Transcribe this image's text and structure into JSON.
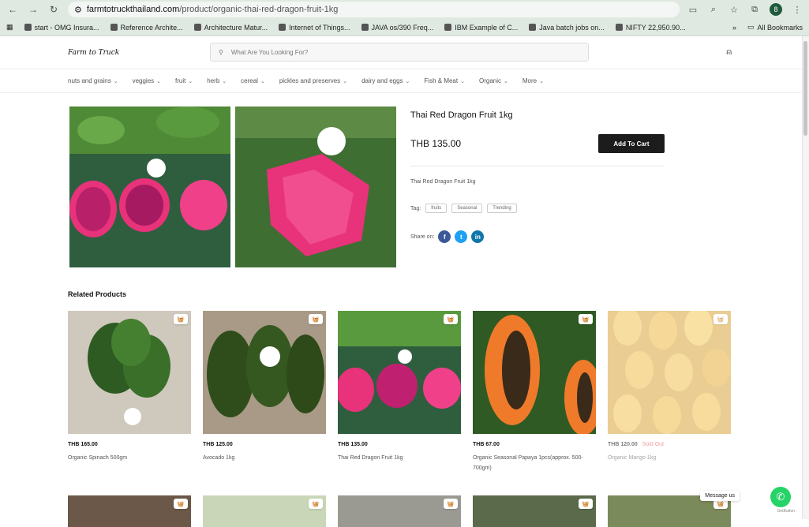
{
  "browser": {
    "url_domain": "farmtotruckthailand.com",
    "url_path": "/product/organic-thai-red-dragon-fruit-1kg",
    "profile_initial": "8",
    "bookmarks": [
      "start - OMG Insura...",
      "Reference Archite...",
      "Architecture Matur...",
      "Internet of Things...",
      "JAVA os/390 Freq...",
      "IBM Example of C...",
      "Java batch jobs on...",
      "NIFTY 22,950.90..."
    ],
    "all_bookmarks": "All Bookmarks"
  },
  "header": {
    "logo_text": "Farm to Truck",
    "search_placeholder": "What Are You Looking For?"
  },
  "categories": [
    "nuts and grains",
    "veggies",
    "fruit",
    "herb",
    "cereal",
    "pickles and preserves",
    "dairy and eggs",
    "Fish & Meat",
    "Organic",
    "More"
  ],
  "product": {
    "title": "Thai Red Dragon Fruit 1kg",
    "price": "THB 135.00",
    "add_to_cart": "Add To Cart",
    "description": "Thai Red Dragon Fruit 1kg",
    "tag_label": "Tag:",
    "tags": [
      "fruits",
      "Seasonal",
      "Trending"
    ],
    "share_label": "Share on:"
  },
  "related": {
    "title": "Related Products",
    "items": [
      {
        "price": "THB 165.00",
        "name": "Organic Spinach 500gm",
        "sold_out": ""
      },
      {
        "price": "THB 125.00",
        "name": "Avocado 1kg",
        "sold_out": ""
      },
      {
        "price": "THB 135.00",
        "name": "Thai Red Dragon Fruit 1kg",
        "sold_out": ""
      },
      {
        "price": "THB 67.00",
        "name": "Organic Seasonal Papaya 1pcs(approx. 500-700gm)",
        "sold_out": ""
      },
      {
        "price": "THB 120.00",
        "name": "Organic Mango 1kg",
        "sold_out": "Sold Out"
      }
    ]
  },
  "whatsapp": {
    "label": "Message us",
    "credit": "GetButton"
  }
}
